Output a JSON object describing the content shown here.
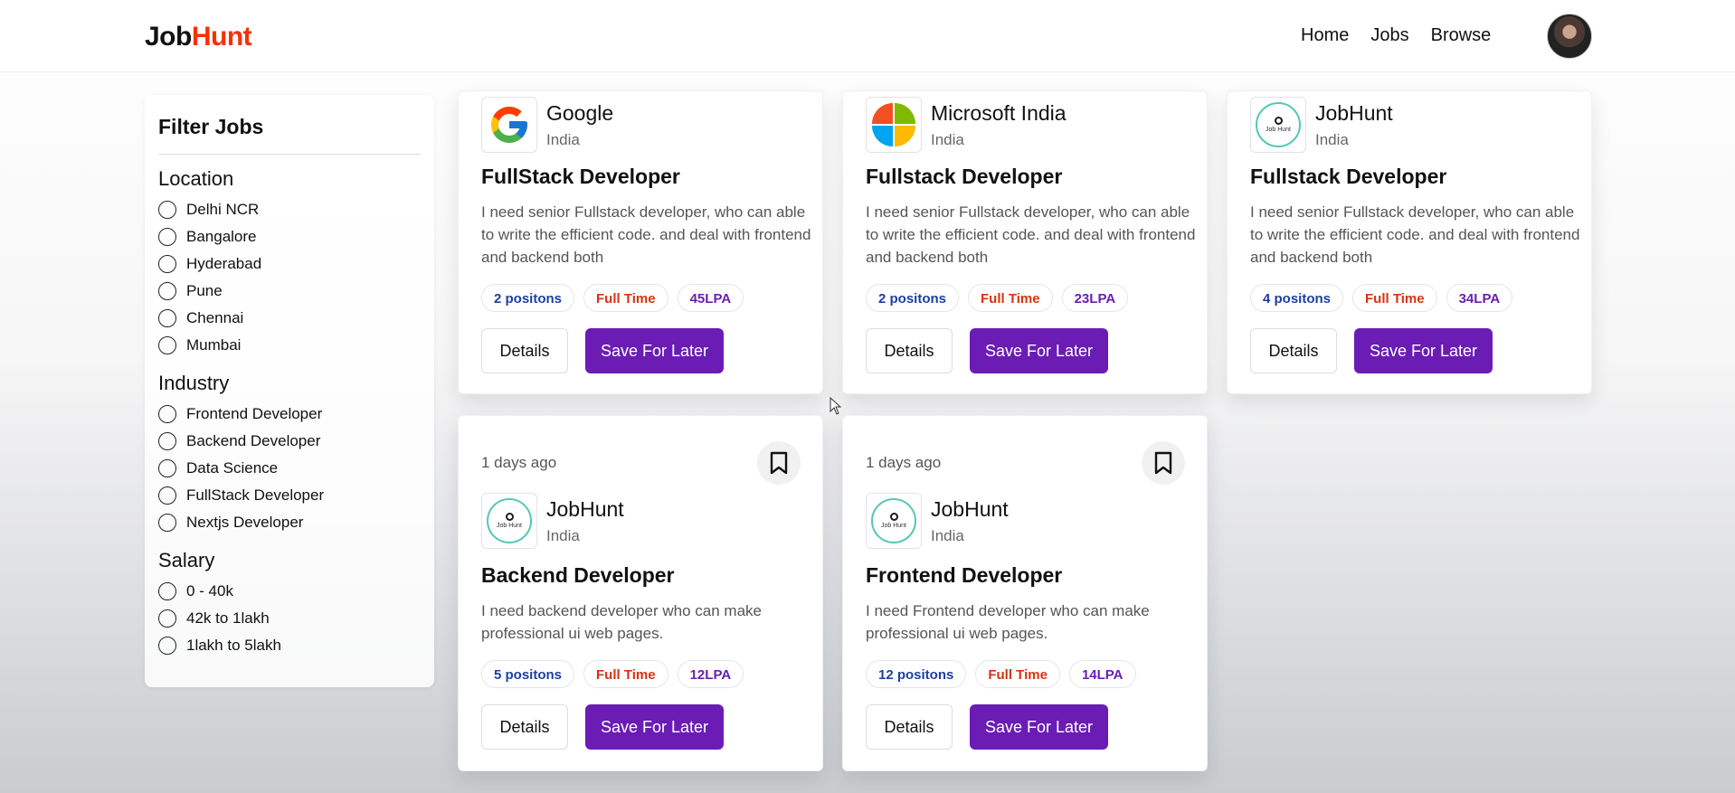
{
  "navbar": {
    "logo_part1": "Job",
    "logo_part2": "Hunt",
    "links": [
      "Home",
      "Jobs",
      "Browse"
    ]
  },
  "sidebar": {
    "title": "Filter Jobs",
    "groups": [
      {
        "title": "Location",
        "options": [
          "Delhi NCR",
          "Bangalore",
          "Hyderabad",
          "Pune",
          "Chennai",
          "Mumbai"
        ]
      },
      {
        "title": "Industry",
        "options": [
          "Frontend Developer",
          "Backend Developer",
          "Data Science",
          "FullStack Developer",
          "Nextjs Developer"
        ]
      },
      {
        "title": "Salary",
        "options": [
          "0 - 40k",
          "42k to 1lakh",
          "1lakh to 5lakh"
        ]
      }
    ]
  },
  "jobs": [
    {
      "company": "Google",
      "location": "India",
      "title": "FullStack Developer",
      "description": "I need senior Fullstack developer, who can able to write the efficient code. and deal with frontend and backend both",
      "positions": "2 positons",
      "type": "Full Time",
      "salary": "45LPA",
      "details_label": "Details",
      "save_label": "Save For Later",
      "logo": "google-logo"
    },
    {
      "company": "Microsoft India",
      "location": "India",
      "title": "Fullstack Developer",
      "description": "I need senior Fullstack developer, who can able to write the efficient code. and deal with frontend and backend both",
      "positions": "2 positons",
      "type": "Full Time",
      "salary": "23LPA",
      "details_label": "Details",
      "save_label": "Save For Later",
      "logo": "microsoft-logo"
    },
    {
      "company": "JobHunt",
      "location": "India",
      "title": "Fullstack Developer",
      "description": "I need senior Fullstack developer, who can able to write the efficient code. and deal with frontend and backend both",
      "positions": "4 positons",
      "type": "Full Time",
      "salary": "34LPA",
      "details_label": "Details",
      "save_label": "Save For Later",
      "logo": "jobhunt-logo",
      "logo_text": "Job Hunt"
    },
    {
      "posted": "1 days ago",
      "company": "JobHunt",
      "location": "India",
      "title": "Backend Developer",
      "description": "I need backend developer who can make professional ui web pages.",
      "positions": "5 positons",
      "type": "Full Time",
      "salary": "12LPA",
      "details_label": "Details",
      "save_label": "Save For Later",
      "logo": "jobhunt-logo",
      "logo_text": "Job Hunt"
    },
    {
      "posted": "1 days ago",
      "company": "JobHunt",
      "location": "India",
      "title": "Frontend Developer",
      "description": "I need Frontend developer who can make professional ui web pages.",
      "positions": "12 positons",
      "type": "Full Time",
      "salary": "14LPA",
      "details_label": "Details",
      "save_label": "Save For Later",
      "logo": "jobhunt-logo",
      "logo_text": "Job Hunt"
    }
  ],
  "colors": {
    "brand_red": "#f83002",
    "primary_purple": "#6a1cb5",
    "positions_blue": "#1d3fa0",
    "type_red": "#d6340f",
    "salary_purple": "#6b1fb0"
  },
  "icons": {
    "bookmark": "bookmark-icon",
    "cursor": "mouse-cursor-icon",
    "avatar": "user-avatar"
  }
}
